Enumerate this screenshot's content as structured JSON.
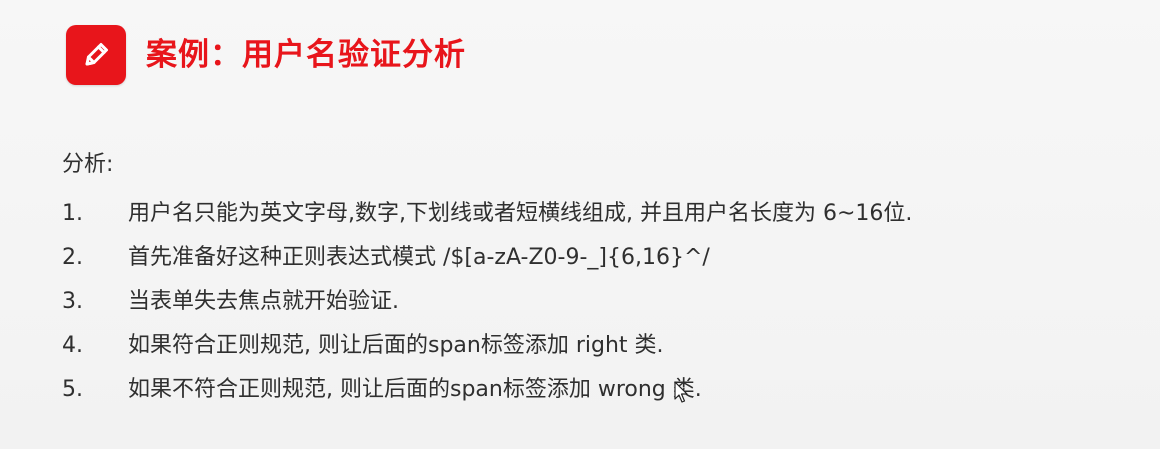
{
  "header": {
    "title": "案例：用户名验证分析",
    "icon": "pencil-icon",
    "accent_color": "#e8151b"
  },
  "content": {
    "section_label": "分析:",
    "items": [
      {
        "number": "1.",
        "text": "用户名只能为英文字母,数字,下划线或者短横线组成, 并且用户名长度为 6~16位."
      },
      {
        "number": "2.",
        "text": "首先准备好这种正则表达式模式 /$[a-zA-Z0-9-_]{6,16}^/"
      },
      {
        "number": "3.",
        "text": "当表单失去焦点就开始验证."
      },
      {
        "number": "4.",
        "text": "如果符合正则规范, 则让后面的span标签添加 right 类."
      },
      {
        "number": "5.",
        "text": "如果不符合正则规范, 则让后面的span标签添加 wrong 类."
      }
    ]
  },
  "overlay": {
    "cursor_icon": "mouse-cursor-icon"
  }
}
